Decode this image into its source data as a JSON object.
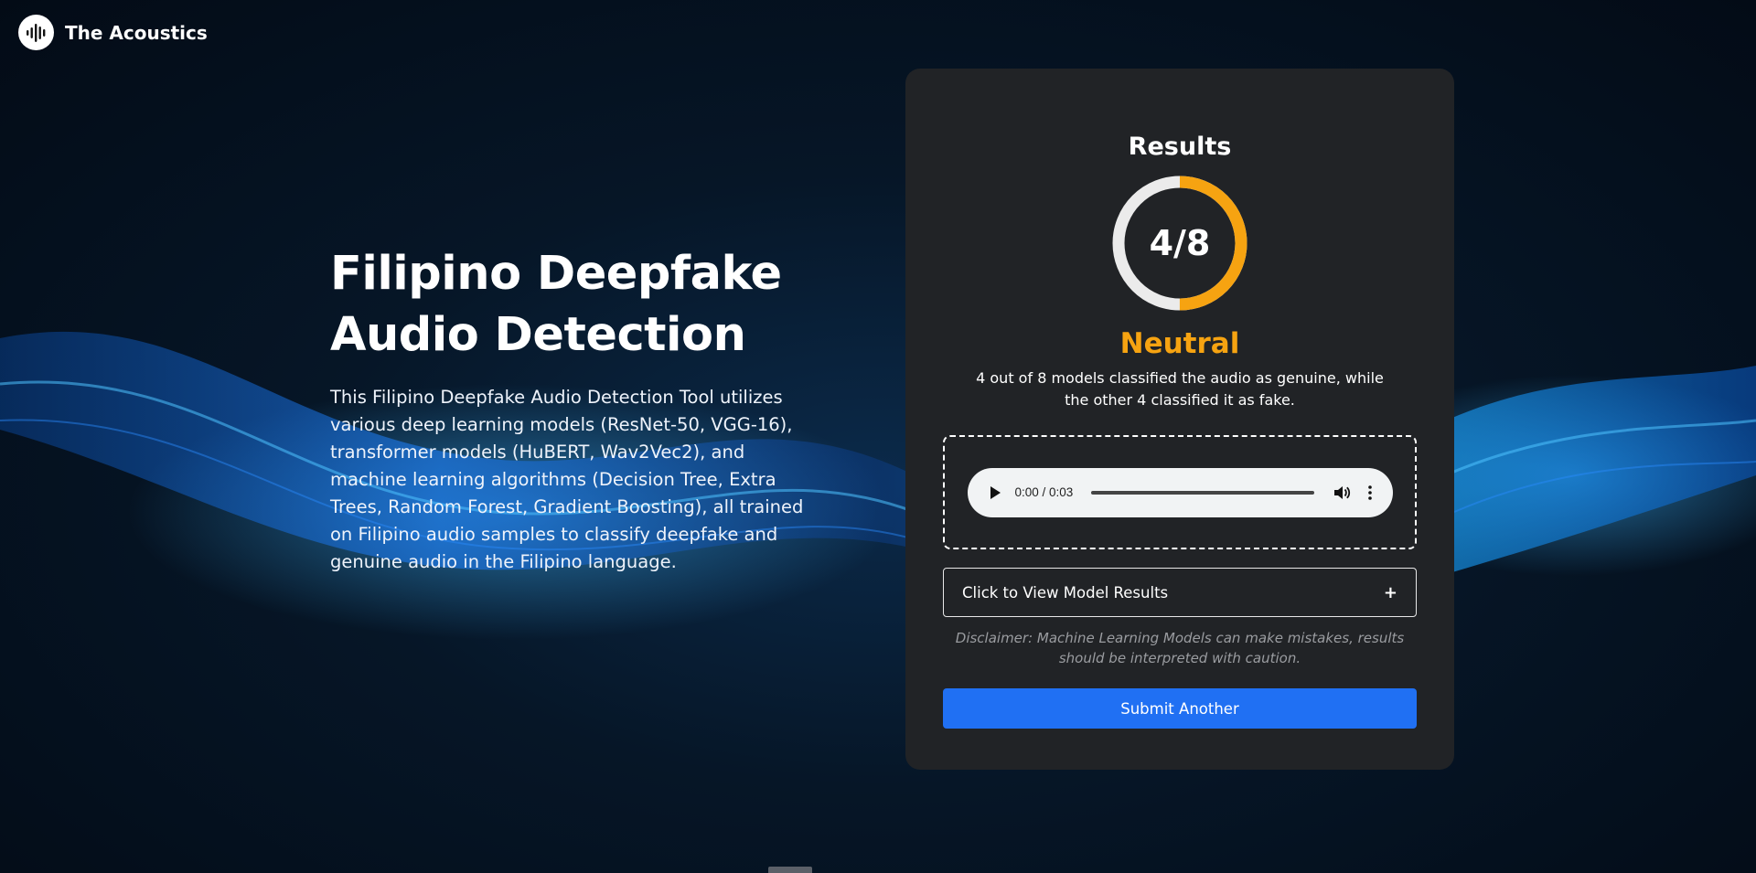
{
  "brand": {
    "name": "The Acoustics",
    "icon": "soundwave-logo-icon"
  },
  "hero": {
    "title": "Filipino Deepfake Audio Detection",
    "description": "This Filipino Deepfake Audio Detection Tool utilizes various deep learning models (ResNet-50, VGG-16), transformer models (HuBERT, Wav2Vec2), and machine learning algorithms (Decision Tree, Extra Trees, Random Forest, Gradient Boosting), all trained on Filipino audio samples to classify deepfake and genuine audio in the Filipino language."
  },
  "results": {
    "title": "Results",
    "score": "4/8",
    "score_fraction": 0.5,
    "verdict": "Neutral",
    "summary": "4 out of 8 models classified the audio as genuine, while the other 4 classified it as fake."
  },
  "audio_player": {
    "time": "0:00 / 0:03",
    "icons": {
      "play": "play-icon",
      "volume": "volume-icon",
      "more": "more-options-icon"
    }
  },
  "accordion": {
    "label": "Click to View Model Results",
    "icon": "plus-icon",
    "symbol": "+"
  },
  "disclaimer": "Disclaimer: Machine Learning Models can make mistakes, results should be interpreted with caution.",
  "submit": {
    "label": "Submit Another"
  },
  "colors": {
    "accent": "#2070f3",
    "verdict": "#f6a311",
    "ring_track": "#ebebeb",
    "card_bg": "#212326"
  }
}
